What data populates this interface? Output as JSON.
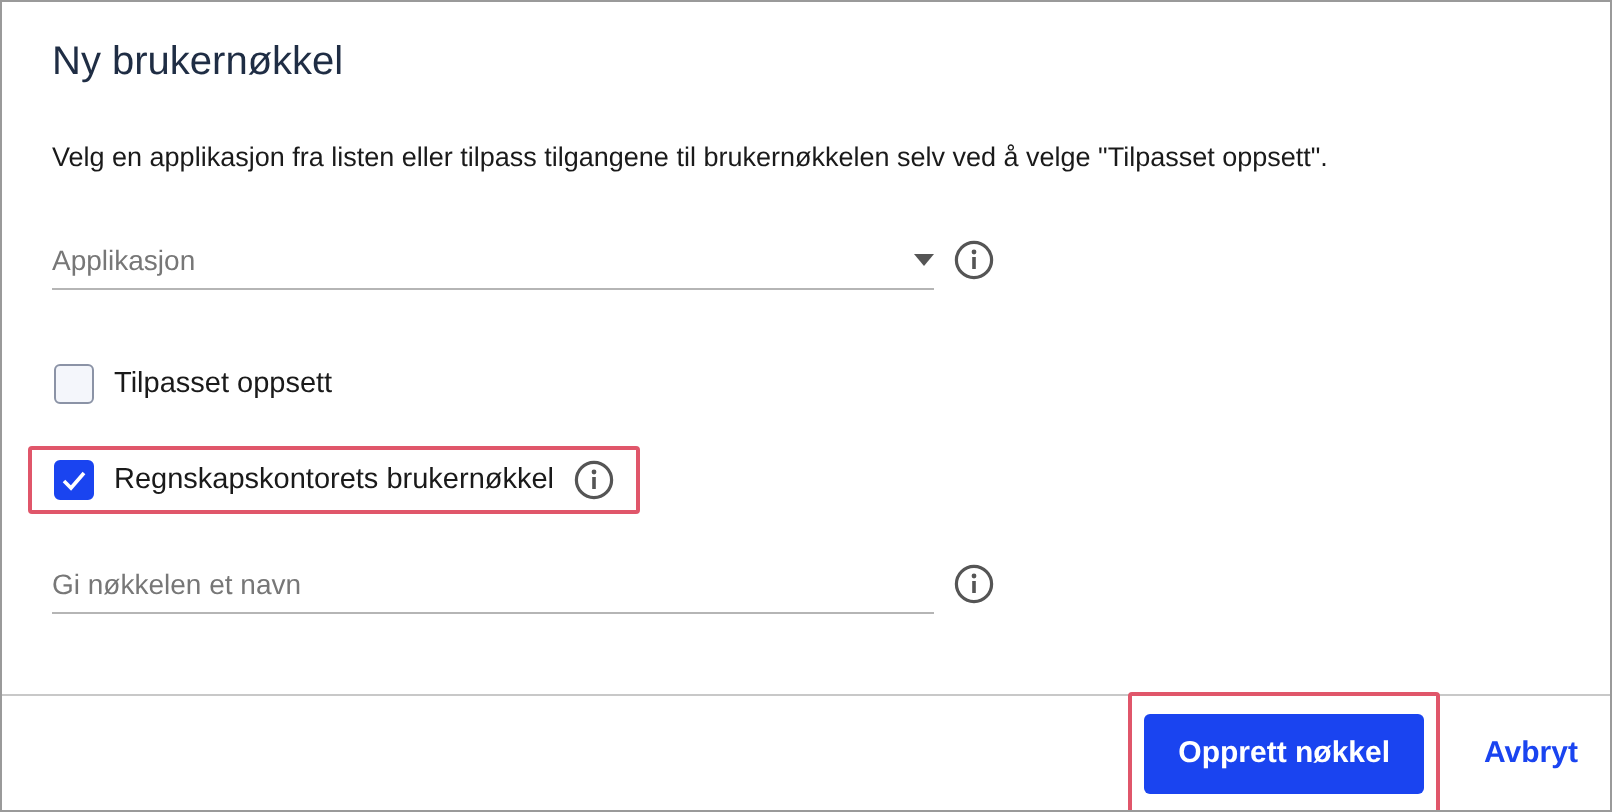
{
  "dialog": {
    "title": "Ny brukernøkkel",
    "description": "Velg en applikasjon fra listen eller tilpass tilgangene til brukernøkkelen selv ved å velge \"Tilpasset oppsett\"."
  },
  "application_field": {
    "placeholder": "Applikasjon",
    "info": true
  },
  "options": [
    {
      "label": "Tilpasset oppsett",
      "checked": false,
      "highlighted": false,
      "info": false
    },
    {
      "label": "Regnskapskontorets brukernøkkel",
      "checked": true,
      "highlighted": true,
      "info": true
    }
  ],
  "name_field": {
    "placeholder": "Gi nøkkelen et navn",
    "info": true
  },
  "buttons": [
    {
      "label": "Opprett nøkkel",
      "kind": "primary",
      "highlighted": true
    },
    {
      "label": "Avbryt",
      "kind": "link",
      "highlighted": false
    }
  ]
}
